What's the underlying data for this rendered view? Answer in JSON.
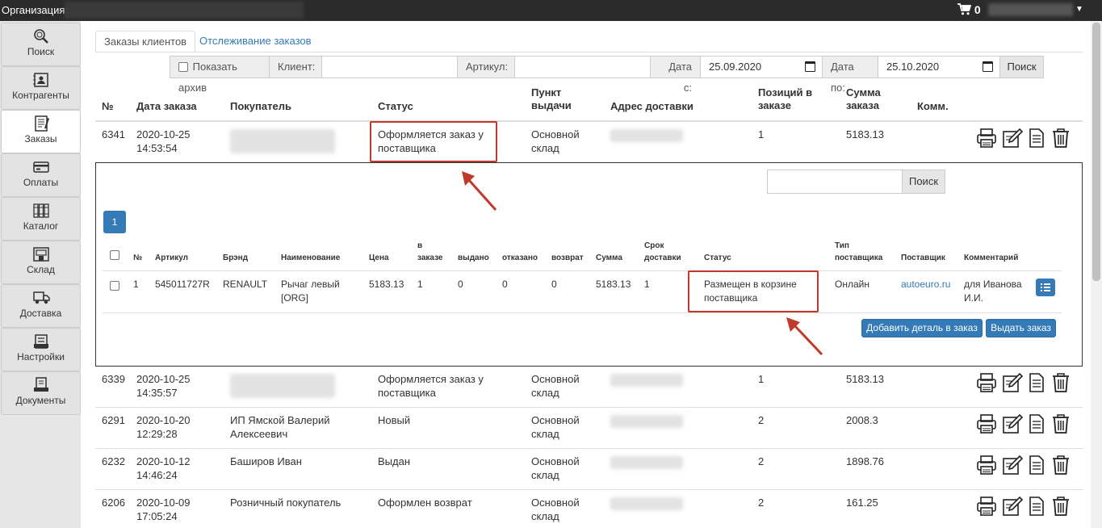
{
  "topbar": {
    "org_label": "Организация:",
    "cart_count": "0"
  },
  "sidebar": {
    "items": [
      {
        "label": "Поиск"
      },
      {
        "label": "Контрагенты"
      },
      {
        "label": "Заказы"
      },
      {
        "label": "Оплаты"
      },
      {
        "label": "Каталог"
      },
      {
        "label": "Склад"
      },
      {
        "label": "Доставка"
      },
      {
        "label": "Настройки"
      },
      {
        "label": "Документы"
      }
    ]
  },
  "tabs": [
    {
      "label": "Заказы клиентов"
    },
    {
      "label": "Отслеживание заказов"
    }
  ],
  "filter": {
    "archive_label": "Показать архив",
    "client_label": "Клиент:",
    "client_value": "",
    "article_label": "Артикул:",
    "article_value": "",
    "date_from_label": "Дата с:",
    "date_from": "25.09.2020",
    "date_to_label": "Дата по:",
    "date_to": "25.10.2020",
    "search_button": "Поиск"
  },
  "table": {
    "headers": {
      "num": "№",
      "date": "Дата заказа",
      "buyer": "Покупатель",
      "status": "Статус",
      "pickup": "Пункт выдачи",
      "address": "Адрес доставки",
      "positions": "Позиций в заказе",
      "sum": "Сумма заказа",
      "comment": "Комм."
    },
    "rows": [
      {
        "num": "6341",
        "date": "2020-10-25 14:53:54",
        "buyer": "",
        "status": "Оформляется заказ у поставщика",
        "pickup": "Основной склад",
        "positions": "1",
        "sum": "5183.13"
      },
      {
        "num": "6339",
        "date": "2020-10-25 14:35:57",
        "buyer": "",
        "status": "Оформляется заказ у поставщика",
        "pickup": "Основной склад",
        "positions": "1",
        "sum": "5183.13"
      },
      {
        "num": "6291",
        "date": "2020-10-20 12:29:28",
        "buyer": "ИП Ямской Валерий Алексеевич",
        "status": "Новый",
        "pickup": "Основной склад",
        "positions": "2",
        "sum": "2008.3"
      },
      {
        "num": "6232",
        "date": "2020-10-12 14:46:24",
        "buyer": "Баширов Иван",
        "status": "Выдан",
        "pickup": "Основной склад",
        "positions": "2",
        "sum": "1898.76"
      },
      {
        "num": "6206",
        "date": "2020-10-09 17:05:24",
        "buyer": "Розничный покупатель",
        "status": "Оформлен возврат",
        "pickup": "Основной склад",
        "positions": "2",
        "sum": "161.25"
      }
    ]
  },
  "detail": {
    "search_value": "",
    "search_button": "Поиск",
    "page": "1",
    "headers": {
      "num": "№",
      "article": "Артикул",
      "brand": "Брэнд",
      "name": "Наименование",
      "price": "Цена",
      "in_order": "в заказе",
      "issued": "выдано",
      "refused": "отказано",
      "returned": "возврат",
      "sum": "Сумма",
      "delivery": "Срок доставки",
      "status": "Статус",
      "supplier_type": "Тип поставщика",
      "supplier": "Поставщик",
      "comment": "Комментарий"
    },
    "row": {
      "num": "1",
      "article": "545011727R",
      "brand": "RENAULT",
      "name": "Рычаг левый [ORG]",
      "price": "5183.13",
      "in_order": "1",
      "issued": "0",
      "refused": "0",
      "returned": "0",
      "sum": "5183.13",
      "delivery": "1",
      "status": "Размещен в корзине поставщика",
      "supplier_type": "Онлайн",
      "supplier": "autoeuro.ru",
      "comment": "для Иванова И.И."
    },
    "add_button": "Добавить деталь в заказ",
    "issue_button": "Выдать заказ"
  },
  "colors": {
    "primary": "#337ab7",
    "highlight": "#c0392b",
    "topbar": "#2b2b2b"
  },
  "icons": [
    "cart-icon",
    "search-icon",
    "contacts-icon",
    "orders-icon",
    "payments-icon",
    "catalog-icon",
    "warehouse-icon",
    "delivery-icon",
    "settings-icon",
    "documents-icon",
    "print-icon",
    "edit-icon",
    "document-icon",
    "trash-icon",
    "list-icon",
    "calendar-icon"
  ]
}
